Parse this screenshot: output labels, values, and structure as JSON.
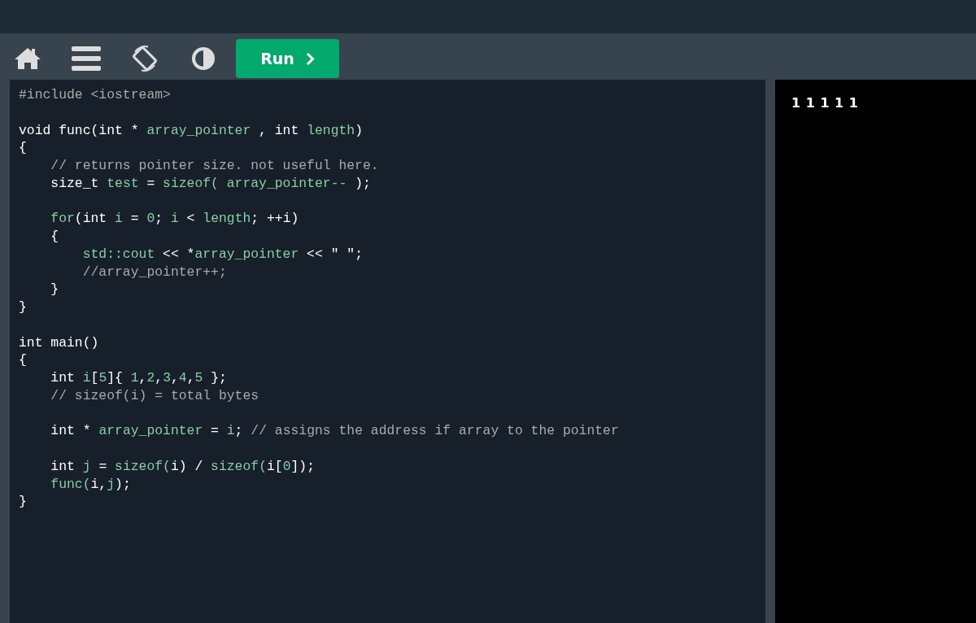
{
  "toolbar": {
    "run_button": {
      "label": "Run"
    }
  },
  "editor": {
    "lines": [
      {
        "kind": "code",
        "tokens": [
          {
            "kind": "comment",
            "text": "#include <iostream>"
          }
        ]
      },
      {
        "kind": "blank"
      },
      {
        "kind": "code",
        "tokens": [
          {
            "kind": "plain",
            "text": "void func(int * "
          },
          {
            "kind": "name",
            "text": "array_pointer"
          },
          {
            "kind": "plain",
            "text": " , int "
          },
          {
            "kind": "name",
            "text": "length"
          },
          {
            "kind": "plain",
            "text": ")"
          }
        ]
      },
      {
        "kind": "code",
        "tokens": [
          {
            "kind": "plain",
            "text": "{"
          }
        ]
      },
      {
        "kind": "code",
        "tokens": [
          {
            "kind": "comment",
            "text": "    // returns pointer size. not useful here."
          }
        ]
      },
      {
        "kind": "code",
        "tokens": [
          {
            "kind": "plain",
            "text": "    size_t "
          },
          {
            "kind": "name",
            "text": "test"
          },
          {
            "kind": "plain",
            "text": " = "
          },
          {
            "kind": "name",
            "text": "sizeof( array_pointer--"
          },
          {
            "kind": "plain",
            "text": " );"
          }
        ]
      },
      {
        "kind": "blank"
      },
      {
        "kind": "code",
        "tokens": [
          {
            "kind": "name",
            "text": "    for"
          },
          {
            "kind": "plain",
            "text": "(int "
          },
          {
            "kind": "name",
            "text": "i"
          },
          {
            "kind": "plain",
            "text": " = "
          },
          {
            "kind": "name",
            "text": "0"
          },
          {
            "kind": "plain",
            "text": "; "
          },
          {
            "kind": "name",
            "text": "i"
          },
          {
            "kind": "plain",
            "text": " < "
          },
          {
            "kind": "name",
            "text": "length"
          },
          {
            "kind": "plain",
            "text": "; ++i)"
          }
        ]
      },
      {
        "kind": "code",
        "tokens": [
          {
            "kind": "plain",
            "text": "    {"
          }
        ]
      },
      {
        "kind": "code",
        "tokens": [
          {
            "kind": "name",
            "text": "        std::cout"
          },
          {
            "kind": "plain",
            "text": " << *"
          },
          {
            "kind": "name",
            "text": "array_pointer"
          },
          {
            "kind": "plain",
            "text": " << \" \";"
          }
        ]
      },
      {
        "kind": "code",
        "tokens": [
          {
            "kind": "comment",
            "text": "        //array_pointer++;"
          }
        ]
      },
      {
        "kind": "code",
        "tokens": [
          {
            "kind": "plain",
            "text": "    }"
          }
        ]
      },
      {
        "kind": "code",
        "tokens": [
          {
            "kind": "plain",
            "text": "}"
          }
        ]
      },
      {
        "kind": "blank"
      },
      {
        "kind": "code",
        "tokens": [
          {
            "kind": "plain",
            "text": "int main()"
          }
        ]
      },
      {
        "kind": "code",
        "tokens": [
          {
            "kind": "plain",
            "text": "{"
          }
        ]
      },
      {
        "kind": "code",
        "tokens": [
          {
            "kind": "plain",
            "text": "    int "
          },
          {
            "kind": "name",
            "text": "i"
          },
          {
            "kind": "plain",
            "text": "["
          },
          {
            "kind": "name",
            "text": "5"
          },
          {
            "kind": "plain",
            "text": "]{ "
          },
          {
            "kind": "name",
            "text": "1"
          },
          {
            "kind": "plain",
            "text": ","
          },
          {
            "kind": "name",
            "text": "2"
          },
          {
            "kind": "plain",
            "text": ","
          },
          {
            "kind": "name",
            "text": "3"
          },
          {
            "kind": "plain",
            "text": ","
          },
          {
            "kind": "name",
            "text": "4"
          },
          {
            "kind": "plain",
            "text": ","
          },
          {
            "kind": "name",
            "text": "5"
          },
          {
            "kind": "plain",
            "text": " };"
          }
        ]
      },
      {
        "kind": "code",
        "tokens": [
          {
            "kind": "comment",
            "text": "    // sizeof(i) = total bytes"
          }
        ]
      },
      {
        "kind": "blank"
      },
      {
        "kind": "code",
        "tokens": [
          {
            "kind": "plain",
            "text": "    int * "
          },
          {
            "kind": "name",
            "text": "array_pointer"
          },
          {
            "kind": "plain",
            "text": " = "
          },
          {
            "kind": "name",
            "text": "i"
          },
          {
            "kind": "plain",
            "text": "; "
          },
          {
            "kind": "comment",
            "text": "// assigns the address if array to the pointer"
          }
        ]
      },
      {
        "kind": "blank"
      },
      {
        "kind": "code",
        "tokens": [
          {
            "kind": "plain",
            "text": "    int "
          },
          {
            "kind": "name",
            "text": "j"
          },
          {
            "kind": "plain",
            "text": " = "
          },
          {
            "kind": "name",
            "text": "sizeof("
          },
          {
            "kind": "plain",
            "text": "i) / "
          },
          {
            "kind": "name",
            "text": "sizeof("
          },
          {
            "kind": "plain",
            "text": "i["
          },
          {
            "kind": "name",
            "text": "0"
          },
          {
            "kind": "plain",
            "text": "]);"
          }
        ]
      },
      {
        "kind": "code",
        "tokens": [
          {
            "kind": "name",
            "text": "    func("
          },
          {
            "kind": "plain",
            "text": "i,"
          },
          {
            "kind": "name",
            "text": "j"
          },
          {
            "kind": "plain",
            "text": ");"
          }
        ]
      },
      {
        "kind": "code",
        "tokens": [
          {
            "kind": "plain",
            "text": "}"
          }
        ]
      }
    ]
  },
  "output": {
    "text": "1 1 1 1 1"
  }
}
